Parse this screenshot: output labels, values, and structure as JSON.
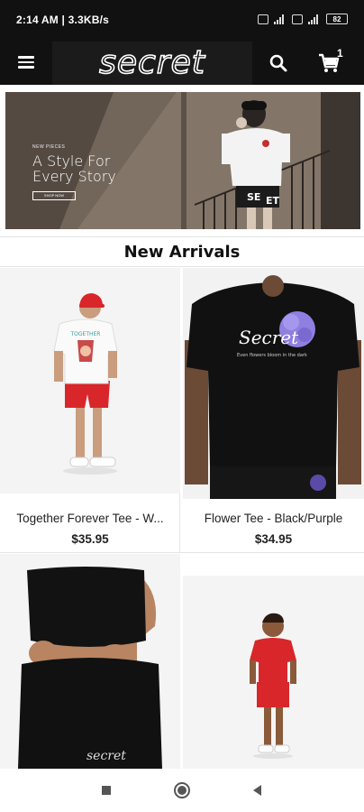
{
  "status_bar": {
    "time": "2:14 AM | 3.3KB/s",
    "battery": "82"
  },
  "header": {
    "logo_text": "secret",
    "cart_count": "1",
    "icons": {
      "menu": "hamburger-menu-icon",
      "search": "search-icon",
      "cart": "shopping-cart-icon"
    }
  },
  "hero": {
    "kicker": "NEW PIECES",
    "title_line1": "A Style For",
    "title_line2": "Every Story",
    "button_label": "SHOP NOW"
  },
  "section": {
    "title": "New Arrivals"
  },
  "products": [
    {
      "name": "Together Forever Tee - W...",
      "price": "$35.95"
    },
    {
      "name": "Flower Tee - Black/Purple",
      "price": "$34.95"
    },
    {
      "name": "",
      "price": ""
    },
    {
      "name": "",
      "price": ""
    }
  ],
  "colors": {
    "header_bg": "#111111",
    "accent_red": "#d9262a",
    "flower_purple": "#8f7fe0"
  },
  "nav_bar": {
    "icons": [
      "recents-square-icon",
      "home-circle-icon",
      "back-triangle-icon"
    ]
  }
}
